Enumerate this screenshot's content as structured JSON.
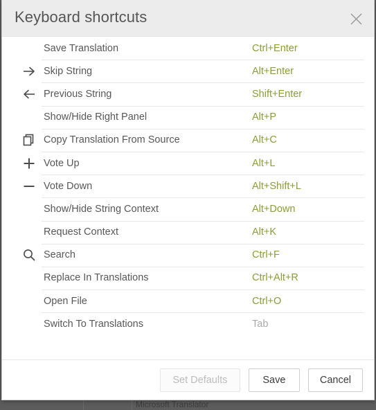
{
  "dialog": {
    "title": "Keyboard shortcuts",
    "close_icon": "close-icon"
  },
  "shortcuts": [
    {
      "icon": "none",
      "label": "Save Translation",
      "keys": "Ctrl+Enter",
      "muted": false
    },
    {
      "icon": "arrow-right",
      "label": "Skip String",
      "keys": "Alt+Enter",
      "muted": false
    },
    {
      "icon": "arrow-left",
      "label": "Previous String",
      "keys": "Shift+Enter",
      "muted": false
    },
    {
      "icon": "none",
      "label": "Show/Hide Right Panel",
      "keys": "Alt+P",
      "muted": false
    },
    {
      "icon": "copy",
      "label": "Copy Translation From Source",
      "keys": "Alt+C",
      "muted": false
    },
    {
      "icon": "plus",
      "label": "Vote Up",
      "keys": "Alt+L",
      "muted": false
    },
    {
      "icon": "minus",
      "label": "Vote Down",
      "keys": "Alt+Shift+L",
      "muted": false
    },
    {
      "icon": "none",
      "label": "Show/Hide String Context",
      "keys": "Alt+Down",
      "muted": false
    },
    {
      "icon": "none",
      "label": "Request Context",
      "keys": "Alt+K",
      "muted": false
    },
    {
      "icon": "search",
      "label": "Search",
      "keys": "Ctrl+F",
      "muted": false
    },
    {
      "icon": "none",
      "label": "Replace In Translations",
      "keys": "Ctrl+Alt+R",
      "muted": false
    },
    {
      "icon": "none",
      "label": "Open File",
      "keys": "Ctrl+O",
      "muted": false
    },
    {
      "icon": "none",
      "label": "Switch To Translations",
      "keys": "Tab",
      "muted": true
    }
  ],
  "footer": {
    "set_defaults_label": "Set Defaults",
    "save_label": "Save",
    "cancel_label": "Cancel"
  },
  "background": {
    "partial_text": "Microsoft Translator"
  },
  "colors": {
    "shortcut_key": "#8d9b38",
    "shortcut_key_muted": "#a9a9a9",
    "label": "#58585a",
    "header_bg": "#ececec",
    "divider": "#e8e8e8"
  }
}
